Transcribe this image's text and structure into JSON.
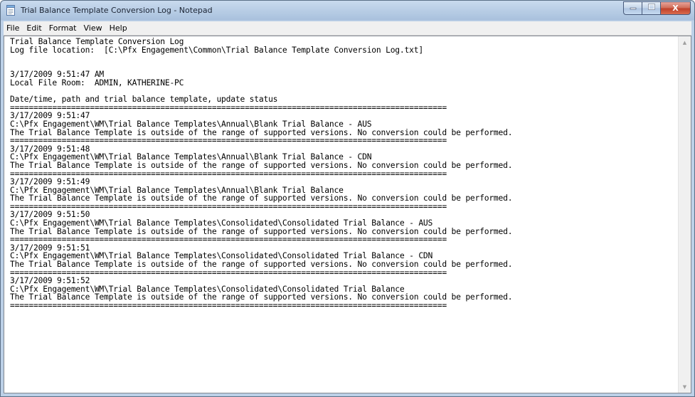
{
  "window": {
    "title": "Trial Balance Template Conversion Log - Notepad",
    "icon": "notepad-icon",
    "caption_buttons": {
      "minimize_icon": "minimize-icon",
      "maximize_icon": "maximize-icon",
      "close_icon": "close-icon",
      "close_glyph": "X"
    }
  },
  "menu": {
    "items": [
      {
        "label": "File"
      },
      {
        "label": "Edit"
      },
      {
        "label": "Format"
      },
      {
        "label": "View"
      },
      {
        "label": "Help"
      }
    ]
  },
  "document": {
    "lines": [
      "Trial Balance Template Conversion Log",
      "Log file location:  [C:\\Pfx Engagement\\Common\\Trial Balance Template Conversion Log.txt]",
      "",
      "",
      "3/17/2009 9:51:47 AM",
      "Local File Room:  ADMIN, KATHERINE-PC",
      "",
      "Date/time, path and trial balance template, update status",
      "=============================================================================================",
      "3/17/2009 9:51:47",
      "C:\\Pfx Engagement\\WM\\Trial Balance Templates\\Annual\\Blank Trial Balance - AUS",
      "The Trial Balance Template is outside of the range of supported versions. No conversion could be performed.",
      "=============================================================================================",
      "3/17/2009 9:51:48",
      "C:\\Pfx Engagement\\WM\\Trial Balance Templates\\Annual\\Blank Trial Balance - CDN",
      "The Trial Balance Template is outside of the range of supported versions. No conversion could be performed.",
      "=============================================================================================",
      "3/17/2009 9:51:49",
      "C:\\Pfx Engagement\\WM\\Trial Balance Templates\\Annual\\Blank Trial Balance",
      "The Trial Balance Template is outside of the range of supported versions. No conversion could be performed.",
      "=============================================================================================",
      "3/17/2009 9:51:50",
      "C:\\Pfx Engagement\\WM\\Trial Balance Templates\\Consolidated\\Consolidated Trial Balance - AUS",
      "The Trial Balance Template is outside of the range of supported versions. No conversion could be performed.",
      "=============================================================================================",
      "3/17/2009 9:51:51",
      "C:\\Pfx Engagement\\WM\\Trial Balance Templates\\Consolidated\\Consolidated Trial Balance - CDN",
      "The Trial Balance Template is outside of the range of supported versions. No conversion could be performed.",
      "=============================================================================================",
      "3/17/2009 9:51:52",
      "C:\\Pfx Engagement\\WM\\Trial Balance Templates\\Consolidated\\Consolidated Trial Balance",
      "The Trial Balance Template is outside of the range of supported versions. No conversion could be performed.",
      "============================================================================================="
    ]
  },
  "scrollbar": {
    "up_icon": "scroll-up-arrow-icon",
    "down_icon": "scroll-down-arrow-icon"
  }
}
